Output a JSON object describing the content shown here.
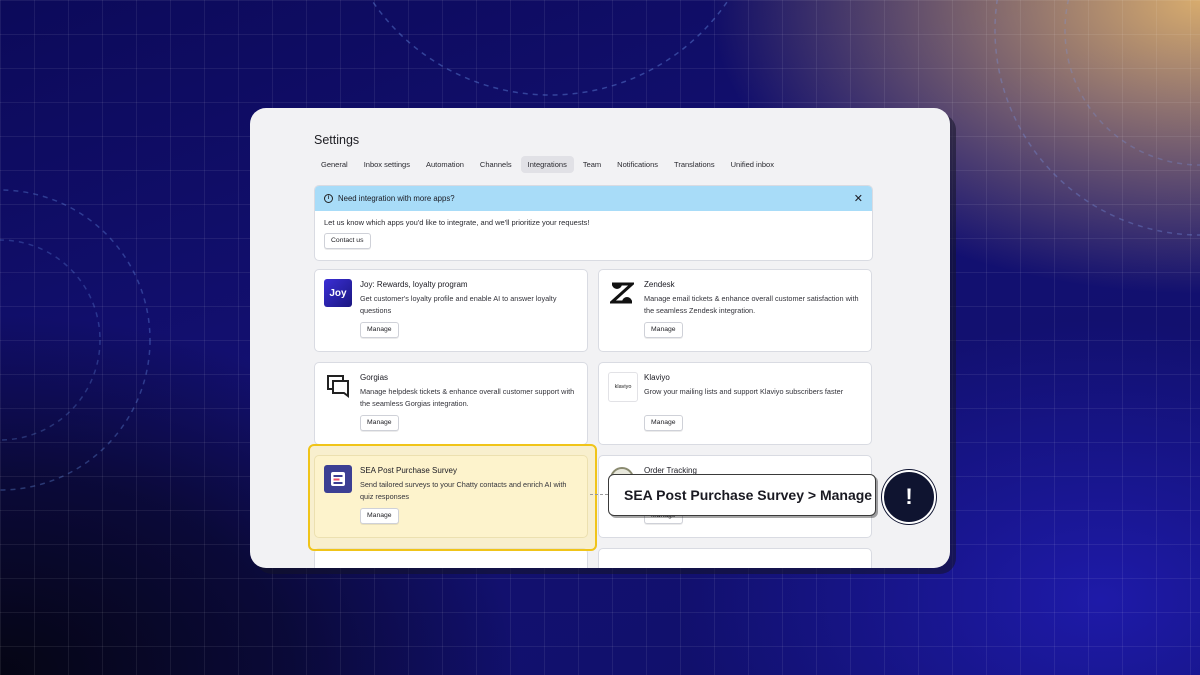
{
  "settings": {
    "title": "Settings",
    "tabs": [
      {
        "label": "General"
      },
      {
        "label": "Inbox settings"
      },
      {
        "label": "Automation"
      },
      {
        "label": "Channels"
      },
      {
        "label": "Integrations",
        "active": true
      },
      {
        "label": "Team"
      },
      {
        "label": "Notifications"
      },
      {
        "label": "Translations"
      },
      {
        "label": "Unified inbox"
      }
    ]
  },
  "banner": {
    "title": "Need integration with more apps?",
    "body": "Let us know which apps you'd like to integrate, and we'll prioritize your requests!",
    "button": "Contact us",
    "color": "#a8dcf8"
  },
  "integrations": [
    {
      "name": "Joy: Rewards, loyalty program",
      "desc": "Get customer's loyalty profile and enable AI to answer loyalty questions",
      "button": "Manage",
      "icon": "joy-logo",
      "logo_text": "Joy"
    },
    {
      "name": "Zendesk",
      "desc": "Manage email tickets & enhance overall customer satisfaction with the seamless Zendesk integration.",
      "button": "Manage",
      "icon": "zendesk-logo"
    },
    {
      "name": "Gorgias",
      "desc": "Manage helpdesk tickets & enhance overall customer support with the seamless Gorgias integration.",
      "button": "Manage",
      "icon": "gorgias-logo"
    },
    {
      "name": "Klaviyo",
      "desc": "Grow your mailing lists and support Klaviyo subscribers faster",
      "button": "Manage",
      "icon": "klaviyo-logo",
      "logo_text": "klaviyo"
    },
    {
      "name": "SEA Post Purchase Survey",
      "desc": "Send tailored surveys to your Chatty contacts and enrich AI with quiz responses",
      "button": "Manage",
      "icon": "sea-survey-logo",
      "highlighted": true
    },
    {
      "name": "Order Tracking",
      "desc": "",
      "button": "Manage",
      "icon": "order-tracking-logo"
    }
  ],
  "callout": {
    "text": "SEA Post Purchase Survey > Manage",
    "alert_symbol": "!",
    "highlight_color": "#f0c419"
  }
}
